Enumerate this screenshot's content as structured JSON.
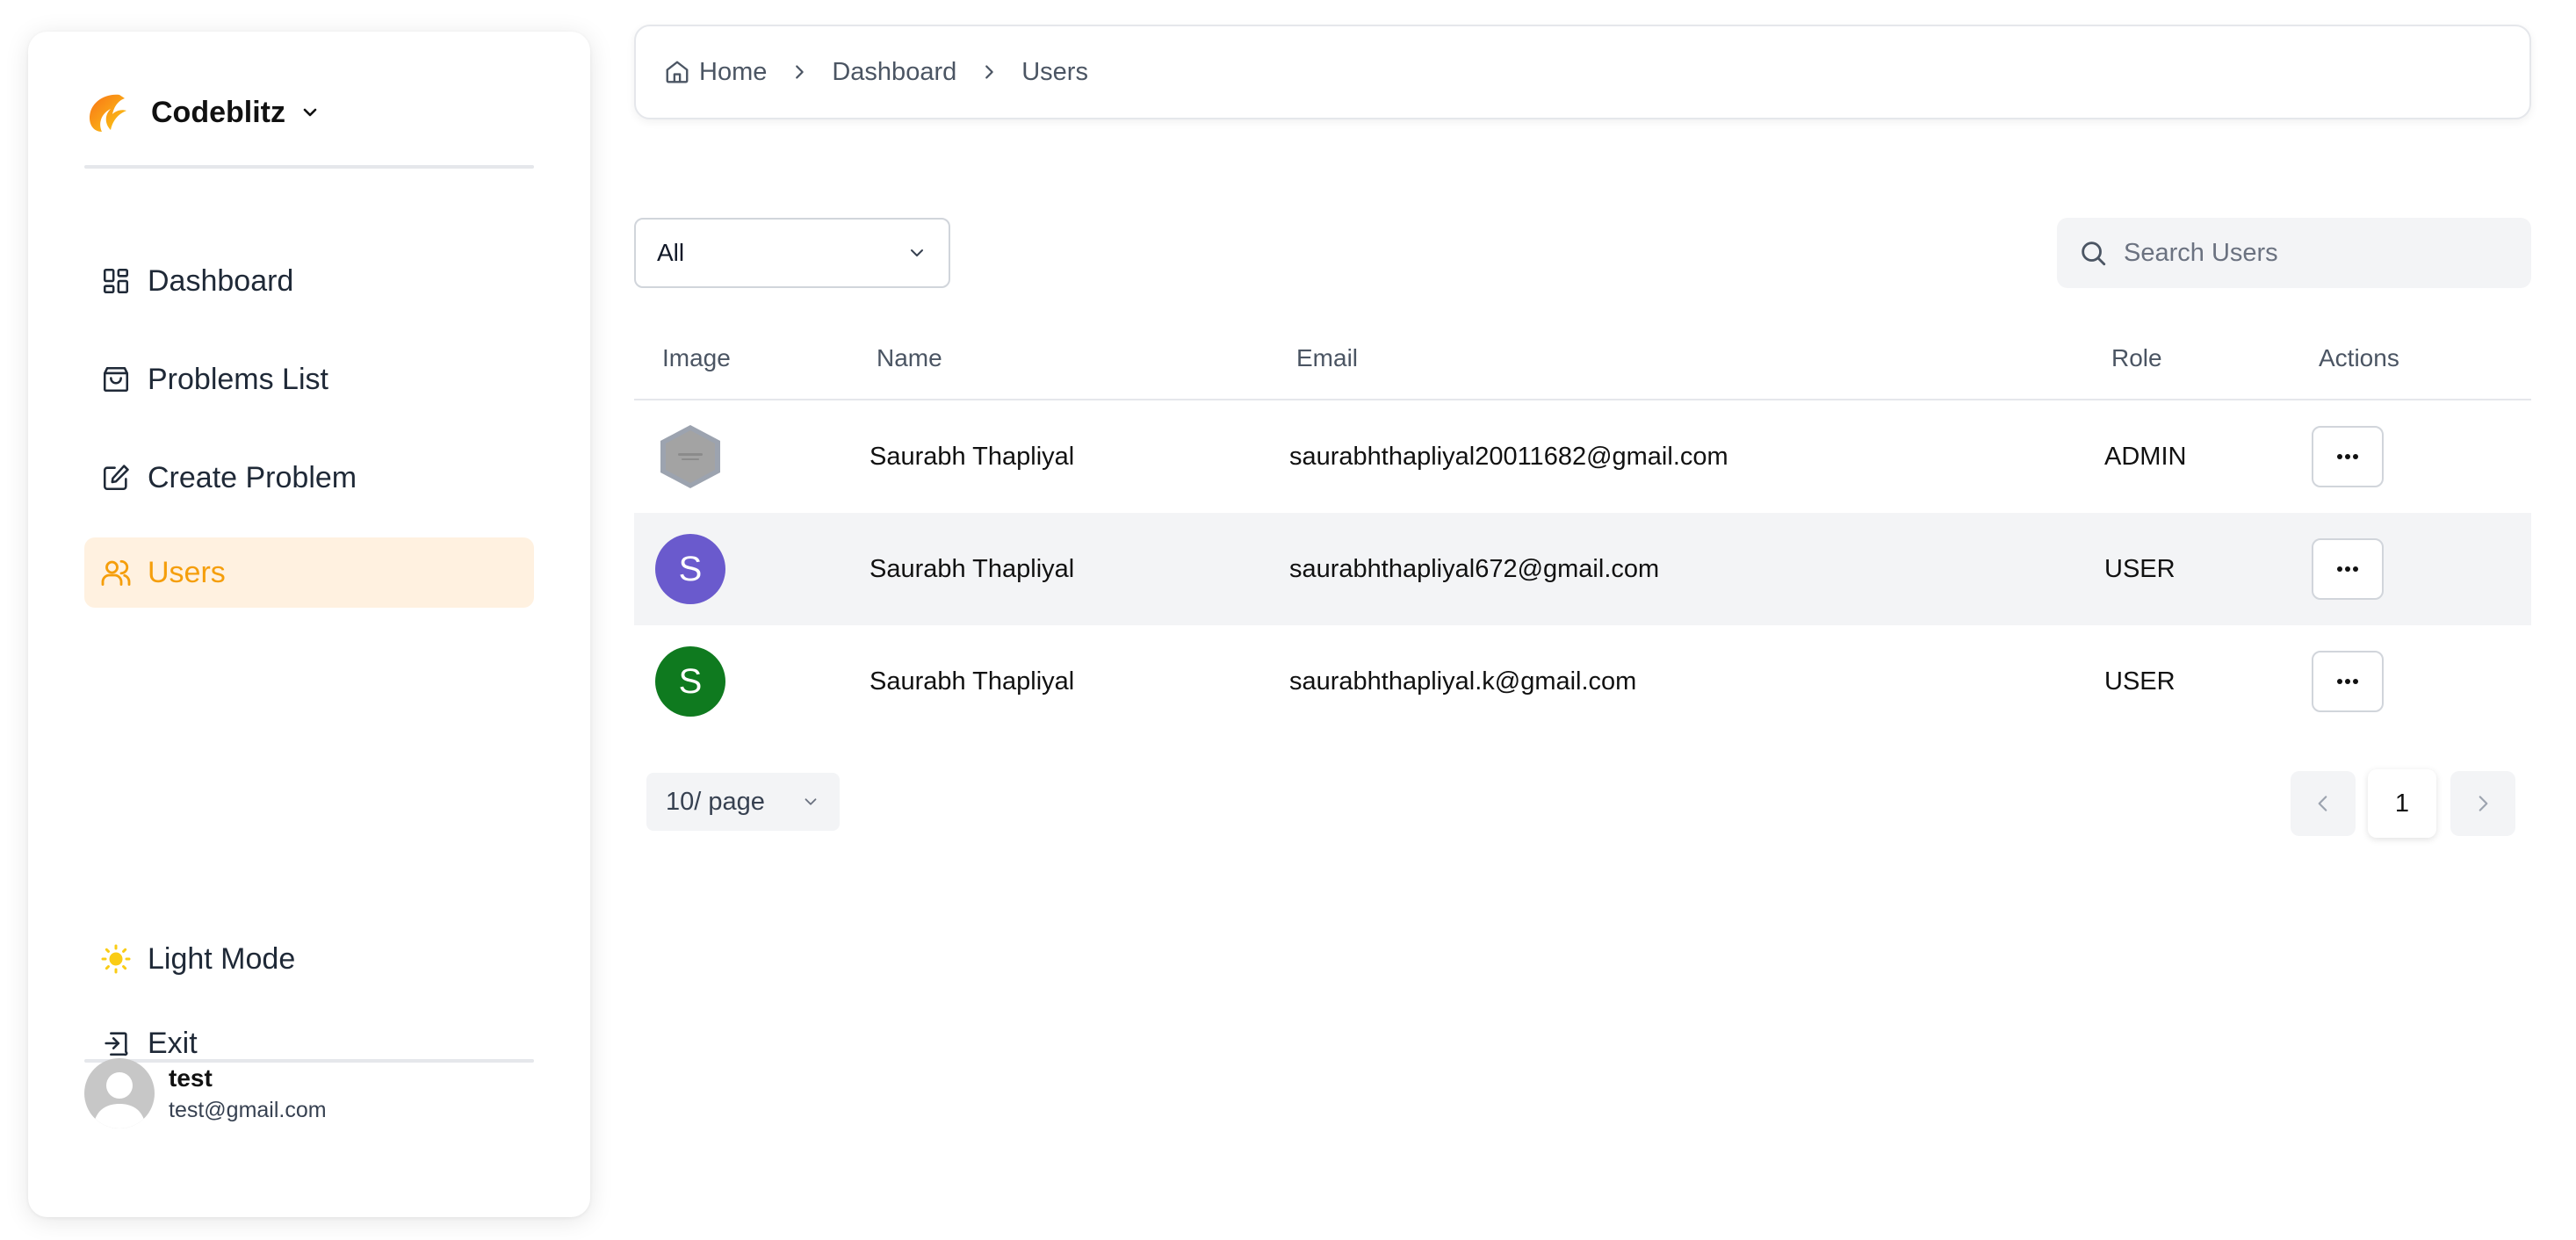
{
  "brand": {
    "name": "Codeblitz",
    "logo_icon": "codeblitz-logo-icon",
    "accent": "#f59e0b"
  },
  "sidebar": {
    "items": [
      {
        "label": "Dashboard",
        "icon": "dashboard-icon",
        "active": false
      },
      {
        "label": "Problems List",
        "icon": "shopping-bag-icon",
        "active": false
      },
      {
        "label": "Create Problem",
        "icon": "edit-icon",
        "active": false
      },
      {
        "label": "Users",
        "icon": "users-icon",
        "active": true
      }
    ],
    "bottom": [
      {
        "label": "Light Mode",
        "icon": "sun-icon"
      },
      {
        "label": "Exit",
        "icon": "exit-icon"
      }
    ],
    "user": {
      "name": "test",
      "email": "test@gmail.com"
    }
  },
  "breadcrumb": [
    "Home",
    "Dashboard",
    "Users"
  ],
  "filter": {
    "value": "All"
  },
  "search": {
    "placeholder": "Search Users",
    "value": ""
  },
  "table": {
    "columns": [
      "Image",
      "Name",
      "Email",
      "Role",
      "Actions"
    ],
    "rows": [
      {
        "avatar": "hexagon",
        "avatar_color": "#9ca3af",
        "name": "Saurabh Thapliyal",
        "email": "saurabhthapliyal20011682@gmail.com",
        "role": "ADMIN"
      },
      {
        "avatar": "S",
        "avatar_color": "#6a5acd",
        "name": "Saurabh Thapliyal",
        "email": "saurabhthapliyal672@gmail.com",
        "role": "USER"
      },
      {
        "avatar": "S",
        "avatar_color": "#0f7a1f",
        "name": "Saurabh Thapliyal",
        "email": "saurabhthapliyal.k@gmail.com",
        "role": "USER"
      }
    ]
  },
  "pagination": {
    "page_size": "10/ page",
    "current_page": "1"
  }
}
